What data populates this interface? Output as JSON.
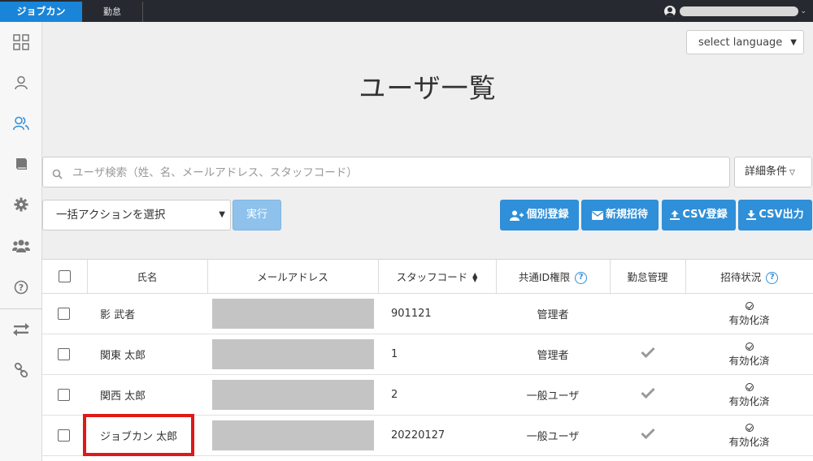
{
  "topbar": {
    "brand": "ジョブカン",
    "tab": "勤怠"
  },
  "header": {
    "language_select": "select language",
    "title": "ユーザ一覧"
  },
  "search": {
    "placeholder": "ユーザ検索（姓、名、メールアドレス、スタッフコード）",
    "detail_label": "詳細条件"
  },
  "actions": {
    "bulk_select": "一括アクションを選択",
    "execute": "実行",
    "individual_register": "個別登録",
    "new_invite": "新規招待",
    "csv_register": "CSV登録",
    "csv_export": "CSV出力"
  },
  "table": {
    "headers": {
      "name": "氏名",
      "email": "メールアドレス",
      "staff_code": "スタッフコード",
      "id_role": "共通ID権限",
      "attendance": "勤怠管理",
      "invite_status": "招待状況"
    },
    "rows": [
      {
        "name": "影 武者",
        "staff_code": "901121",
        "role": "管理者",
        "attendance": false,
        "status": "有効化済"
      },
      {
        "name": "関東 太郎",
        "staff_code": "1",
        "role": "管理者",
        "attendance": true,
        "status": "有効化済"
      },
      {
        "name": "関西 太郎",
        "staff_code": "2",
        "role": "一般ユーザ",
        "attendance": true,
        "status": "有効化済"
      },
      {
        "name": "ジョブカン 太郎",
        "staff_code": "20220127",
        "role": "一般ユーザ",
        "attendance": true,
        "status": "有効化済"
      }
    ]
  },
  "colors": {
    "brand_blue": "#1a85d8",
    "button_blue": "#2f8fd8",
    "highlight_red": "#e01818"
  }
}
